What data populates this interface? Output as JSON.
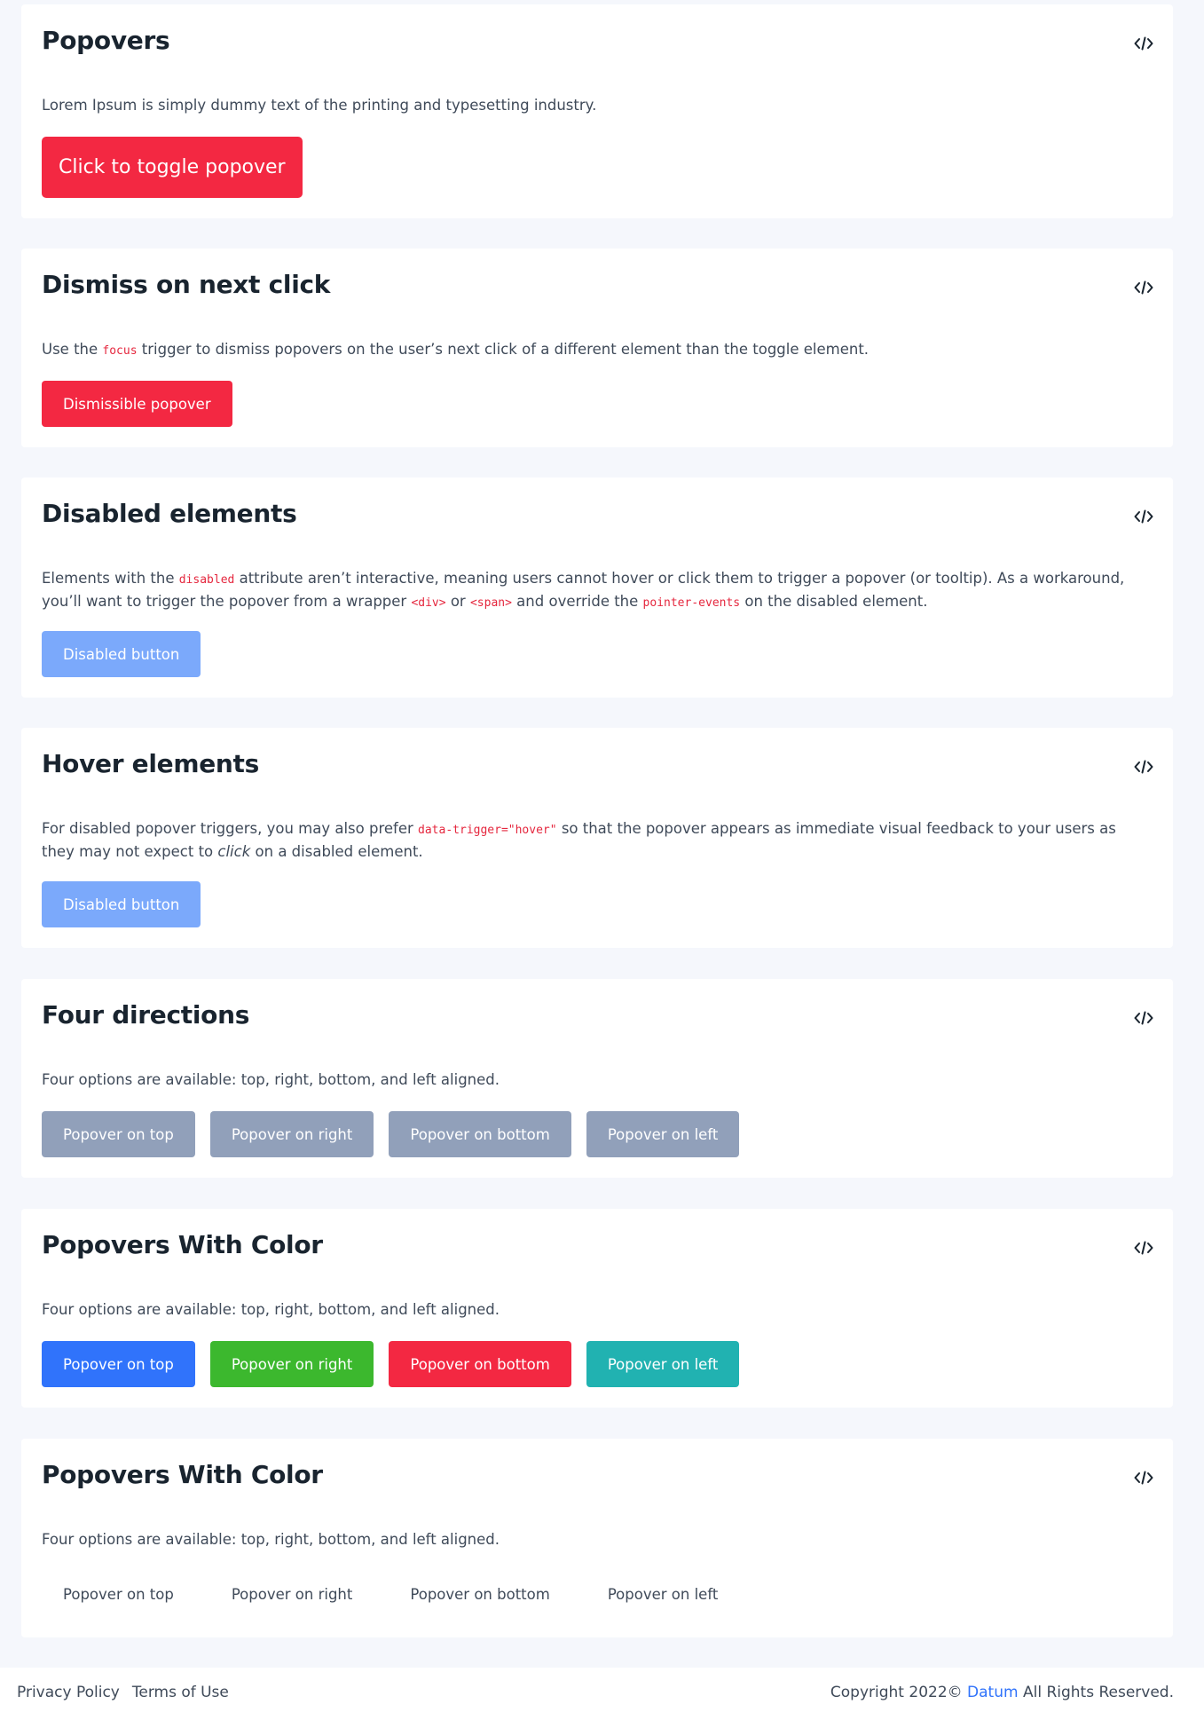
{
  "cards": [
    {
      "title": "Popovers",
      "description": "Lorem Ipsum is simply dummy text of the printing and typesetting industry.",
      "button": "Click to toggle popover"
    },
    {
      "title": "Dismiss on next click",
      "desc_1": "Use the ",
      "code_1": "focus",
      "desc_2": " trigger to dismiss popovers on the user’s next click of a different element than the toggle element.",
      "button": "Dismissible popover"
    },
    {
      "title": "Disabled elements",
      "desc_1": "Elements with the ",
      "code_1": "disabled",
      "desc_2": " attribute aren’t interactive, meaning users cannot hover or click them to trigger a popover (or tooltip). As a workaround, you’ll want to trigger the popover from a wrapper ",
      "code_2": "<div>",
      "desc_3": " or ",
      "code_3": "<span>",
      "desc_4": " and override the ",
      "code_4": "pointer-events",
      "desc_5": " on the disabled element.",
      "button": "Disabled button"
    },
    {
      "title": "Hover elements",
      "desc_1": "For disabled popover triggers, you may also prefer ",
      "code_1": "data-trigger=\"hover\"",
      "desc_2": " so that the popover appears as immediate visual feedback to your users as they may not expect to ",
      "em_1": "click",
      "desc_3": " on a disabled element.",
      "button": "Disabled button"
    },
    {
      "title": "Four directions",
      "description": "Four options are available: top, right, bottom, and left aligned.",
      "buttons": [
        "Popover on top",
        "Popover on right",
        "Popover on bottom",
        "Popover on left"
      ]
    },
    {
      "title": "Popovers With Color",
      "description": "Four options are available: top, right, bottom, and left aligned.",
      "buttons": [
        "Popover on top",
        "Popover on right",
        "Popover on bottom",
        "Popover on left"
      ]
    },
    {
      "title": "Popovers With Color",
      "description": "Four options are available: top, right, bottom, and left aligned.",
      "buttons": [
        "Popover on top",
        "Popover on right",
        "Popover on bottom",
        "Popover on left"
      ]
    }
  ],
  "icons": {
    "code": "code-icon"
  },
  "colors": {
    "danger": "#f32842",
    "disabled": "#7ba9fb",
    "secondary": "#91a0ba",
    "primary": "#3073fb",
    "success": "#3cb82e",
    "info": "#21b2b1"
  },
  "footer": {
    "privacy": "Privacy Policy",
    "terms": "Terms of Use",
    "copyright_prefix": "Copyright 2022© ",
    "brand": "Datum",
    "copyright_suffix": " All Rights Reserved."
  }
}
